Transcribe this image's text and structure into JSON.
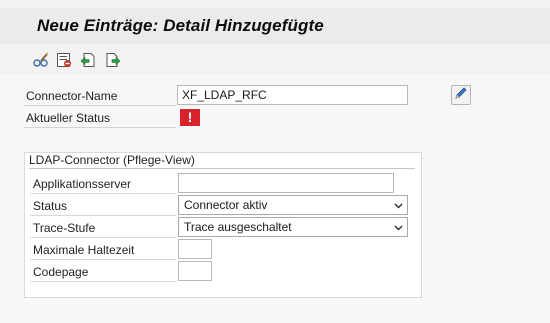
{
  "window": {
    "title": "Neue Einträge: Detail Hinzugefügte"
  },
  "toolbar": {
    "buttons": [
      {
        "name": "glasses-display-icon"
      },
      {
        "name": "delete-list-icon"
      },
      {
        "name": "previous-entry-icon"
      },
      {
        "name": "next-entry-icon"
      }
    ]
  },
  "form": {
    "connector_name_label": "Connector-Name",
    "connector_name_value": "XF_LDAP_RFC",
    "status_label": "Aktueller Status",
    "status_icon_text": "!",
    "status_icon_color": "#d9232c",
    "edit_icon": "pencil-icon"
  },
  "group": {
    "title": "LDAP-Connector (Pflege-View)",
    "fields": {
      "appserver_label": "Applikationsserver",
      "appserver_value": "",
      "status_label": "Status",
      "status_value": "Connector aktiv",
      "trace_label": "Trace-Stufe",
      "trace_value": "Trace ausgeschaltet",
      "max_time_label": "Maximale Haltezeit",
      "max_time_value": "",
      "codepage_label": "Codepage",
      "codepage_value": ""
    }
  }
}
